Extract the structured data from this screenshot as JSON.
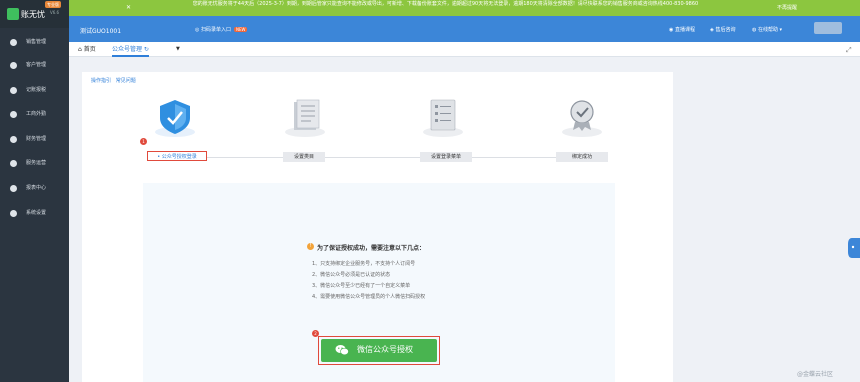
{
  "app": {
    "name": "账无忧",
    "version": "V6.6",
    "badge": "专业版"
  },
  "notice": {
    "text": "您的账无忧服务将于44天后（2025-3-7）到期，到期后管家只能查询不能修改或导出，可新增、下载备份账套文件，逾期超过90天将无法登录，逾期180天将清除全部数据！请尽快联系您的销售服务商或咨询热线400-830-9860",
    "dismiss": "不再提醒"
  },
  "header": {
    "company": "测试GUO1001",
    "scan_entry": "扫码录单入口",
    "new_badge": "NEW",
    "links": [
      "直播课程",
      "售后咨询",
      "在线帮助"
    ]
  },
  "sidebar": {
    "items": [
      {
        "label": "销售管理",
        "icon": "sales-icon"
      },
      {
        "label": "客户管理",
        "icon": "user-icon"
      },
      {
        "label": "记账报税",
        "icon": "book-icon"
      },
      {
        "label": "工商外勤",
        "icon": "briefcase-icon"
      },
      {
        "label": "财务管理",
        "icon": "finance-icon"
      },
      {
        "label": "服务运营",
        "icon": "chat-icon"
      },
      {
        "label": "报表中心",
        "icon": "pie-chart-icon"
      },
      {
        "label": "系统设置",
        "icon": "gear-icon"
      }
    ]
  },
  "tabs": {
    "home": "首页",
    "current": "公众号管理"
  },
  "help": {
    "guide": "操作指引",
    "faq": "常见问题"
  },
  "steps": [
    {
      "label": "• 公众号授权登录",
      "number": "1"
    },
    {
      "label": "设置类目"
    },
    {
      "label": "设置登录菜单"
    },
    {
      "label": "绑定成功"
    }
  ],
  "tips": {
    "title": "为了保证授权成功，需要注意以下几点：",
    "items": [
      "1、只支持绑定企业服务号，不支持个人订阅号",
      "2、微信公众号必须是已认证的状态",
      "3、微信公众号至少已经有了一个自定义菜单",
      "4、需要使用微信公众号管理员的个人微信扫码授权"
    ]
  },
  "auth_button": {
    "label": "微信公众号授权",
    "number": "2"
  },
  "watermark": "@金蝶云社区",
  "colors": {
    "primary": "#3c86d8",
    "notice": "#8cc63f",
    "sidebar": "#2b3540",
    "wechat": "#49b450",
    "highlight": "#e04a3c"
  }
}
